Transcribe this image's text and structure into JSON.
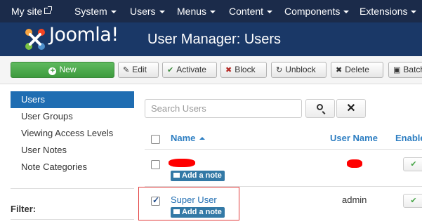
{
  "navbar": {
    "site": "My site",
    "items": [
      "System",
      "Users",
      "Menus",
      "Content",
      "Components",
      "Extensions"
    ]
  },
  "header": {
    "logo_text": "Joomla!",
    "title": "User Manager: Users"
  },
  "toolbar": {
    "new": "New",
    "edit": "Edit",
    "activate": "Activate",
    "block": "Block",
    "unblock": "Unblock",
    "delete": "Delete",
    "batch": "Batch"
  },
  "sidebar": {
    "items": [
      "Users",
      "User Groups",
      "Viewing Access Levels",
      "User Notes",
      "Note Categories"
    ],
    "active": "Users",
    "filter_label": "Filter:"
  },
  "search": {
    "placeholder": "Search Users"
  },
  "table": {
    "headers": {
      "name": "Name",
      "username": "User Name",
      "enabled": "Enabled"
    },
    "rows": [
      {
        "name": "",
        "username": "",
        "note_label": "Add a note",
        "checked": false,
        "redacted": true
      },
      {
        "name": "Super User",
        "username": "admin",
        "note_label": "Add a note",
        "checked": true,
        "redacted": false
      }
    ]
  },
  "colors": {
    "navbar_bg": "#1b2b4a",
    "header_bg": "#1a3867",
    "accent_blue": "#1f6db2",
    "new_button_green": "#46a546",
    "highlight_red": "#e23b3b"
  },
  "icons": {
    "new": "plus-circle-icon",
    "edit": "edit-icon",
    "activate": "check-icon",
    "block": "block-icon",
    "unblock": "unblock-icon",
    "delete": "delete-x-icon",
    "batch": "batch-icon",
    "search": "search-icon",
    "clear": "clear-x-icon"
  }
}
